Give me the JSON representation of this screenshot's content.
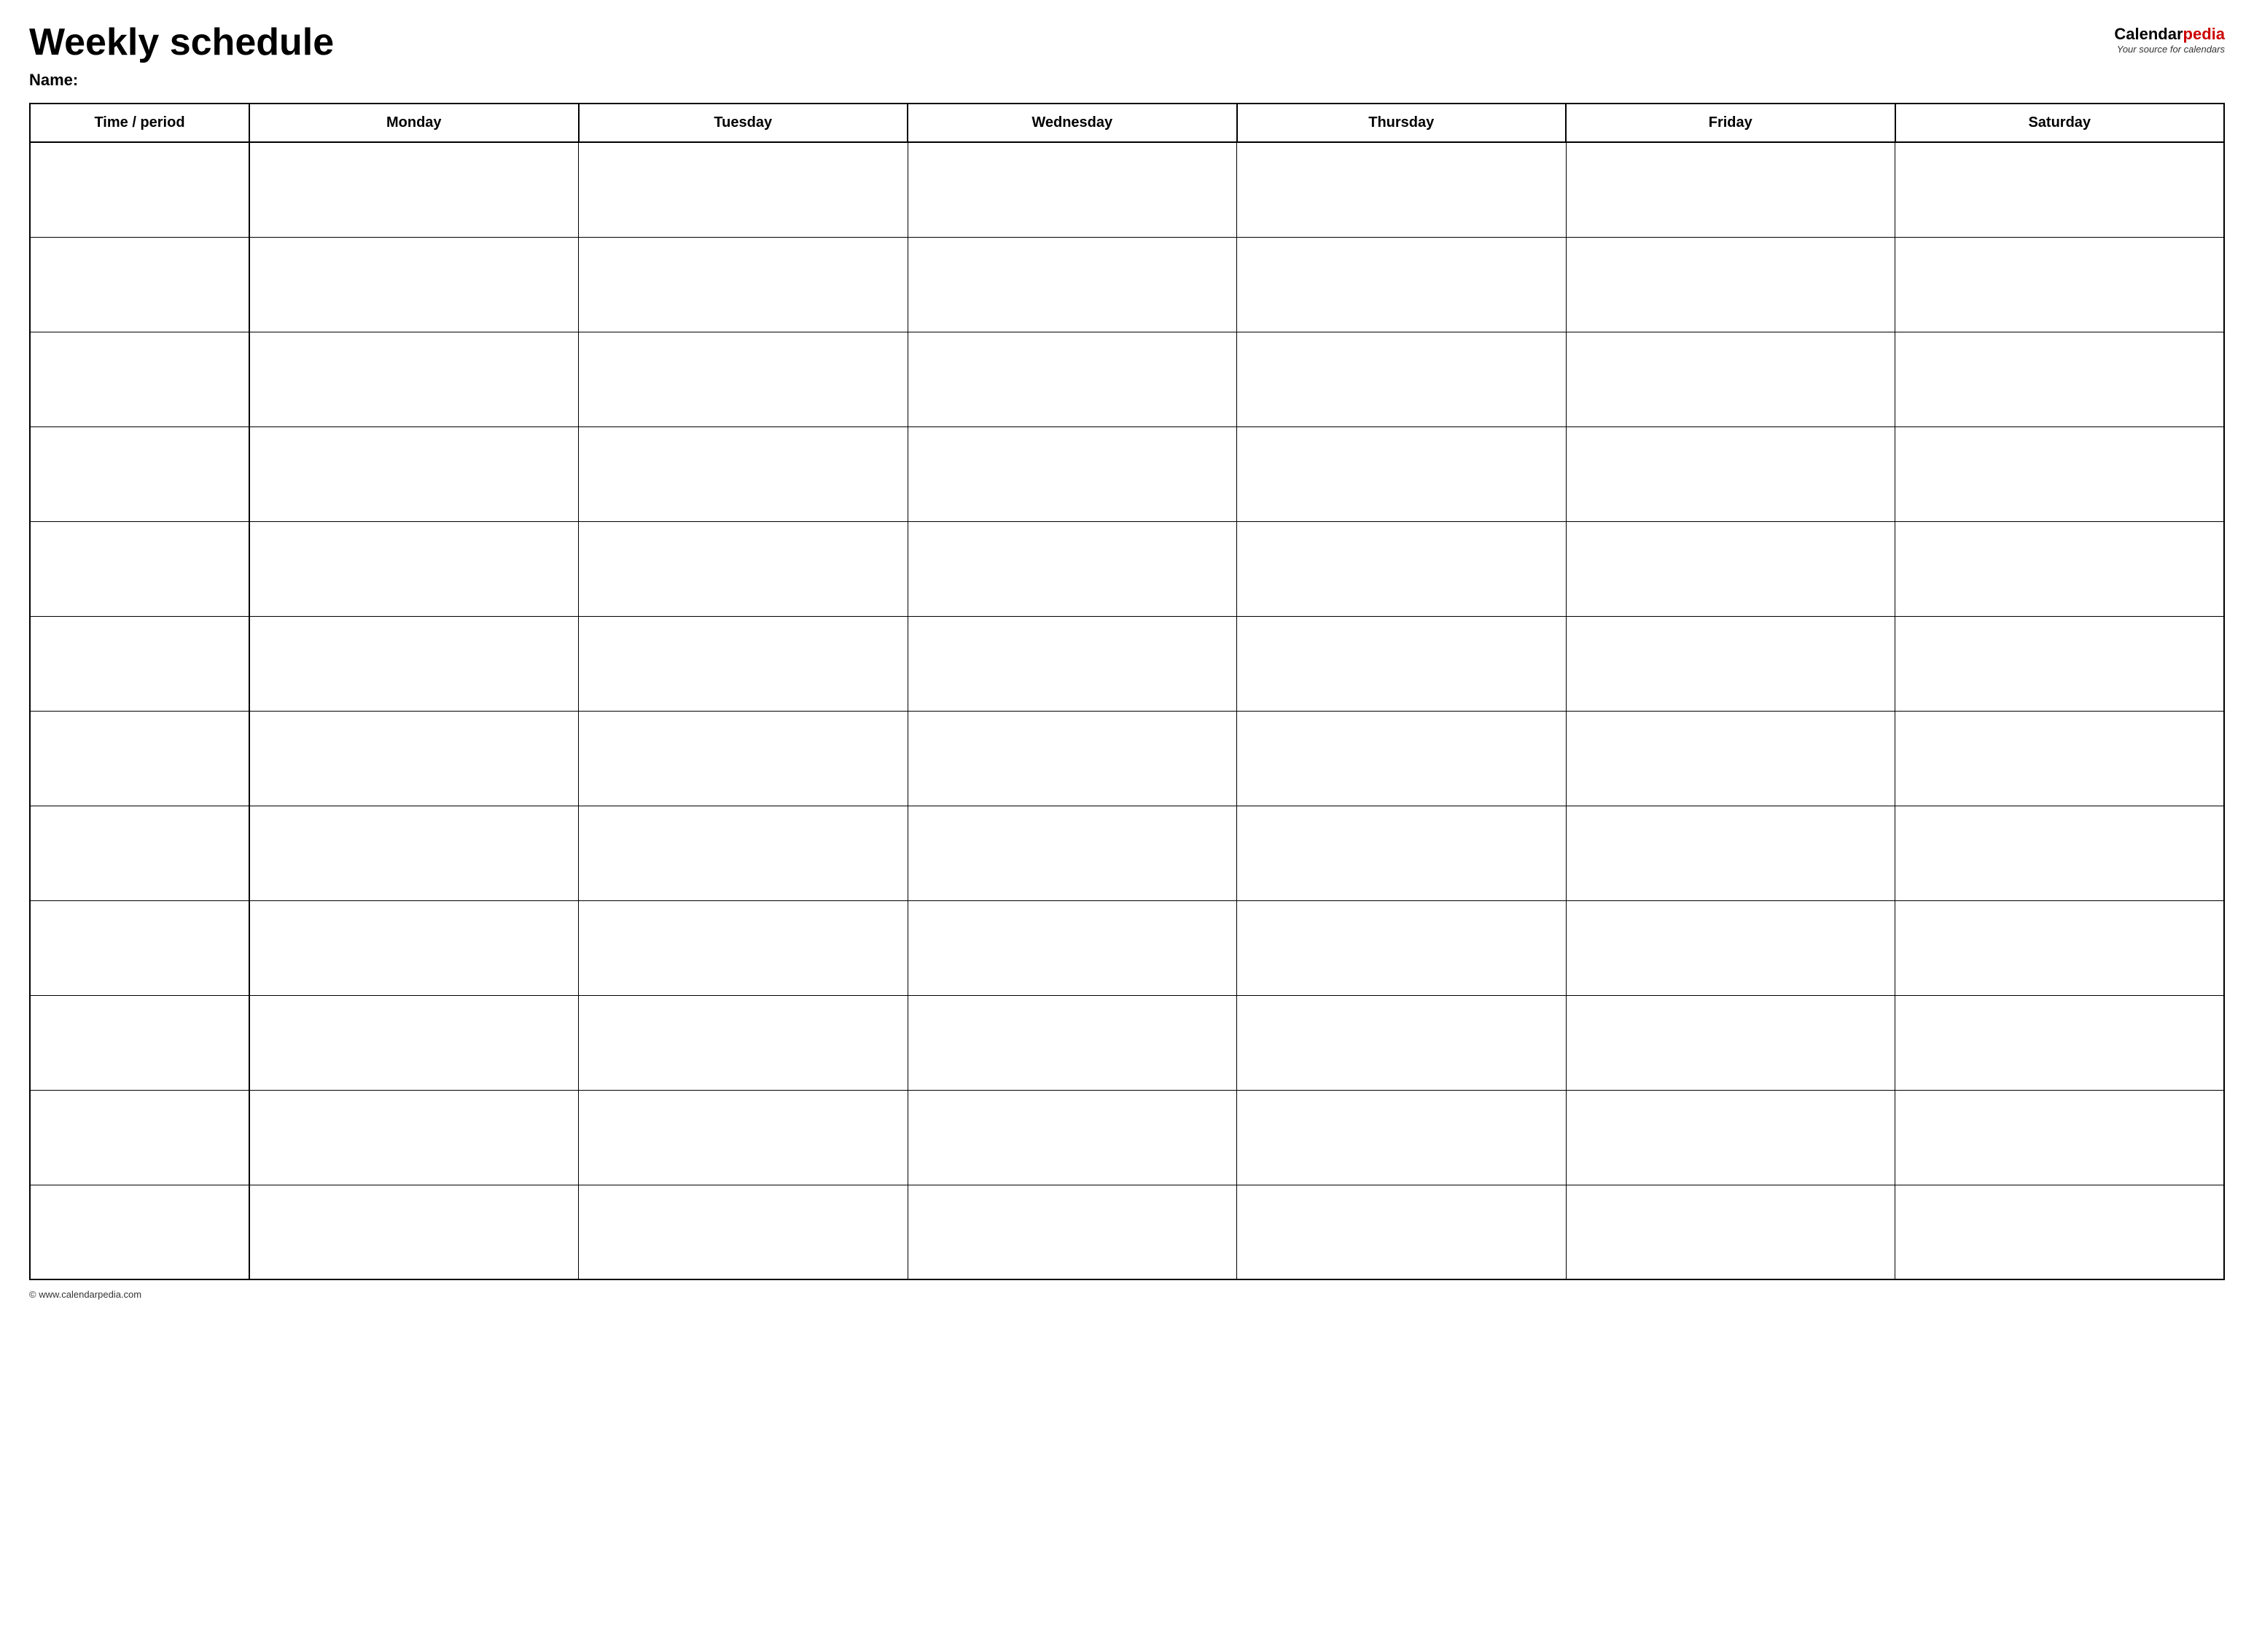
{
  "header": {
    "title": "Weekly schedule",
    "logo_calendar": "Calendar",
    "logo_pedia": "pedia",
    "logo_subtitle": "Your source for calendars",
    "name_label": "Name:"
  },
  "table": {
    "columns": [
      {
        "id": "time",
        "label": "Time / period"
      },
      {
        "id": "monday",
        "label": "Monday"
      },
      {
        "id": "tuesday",
        "label": "Tuesday"
      },
      {
        "id": "wednesday",
        "label": "Wednesday"
      },
      {
        "id": "thursday",
        "label": "Thursday"
      },
      {
        "id": "friday",
        "label": "Friday"
      },
      {
        "id": "saturday",
        "label": "Saturday"
      }
    ],
    "row_count": 12
  },
  "footer": {
    "text": "© www.calendarpedia.com"
  }
}
